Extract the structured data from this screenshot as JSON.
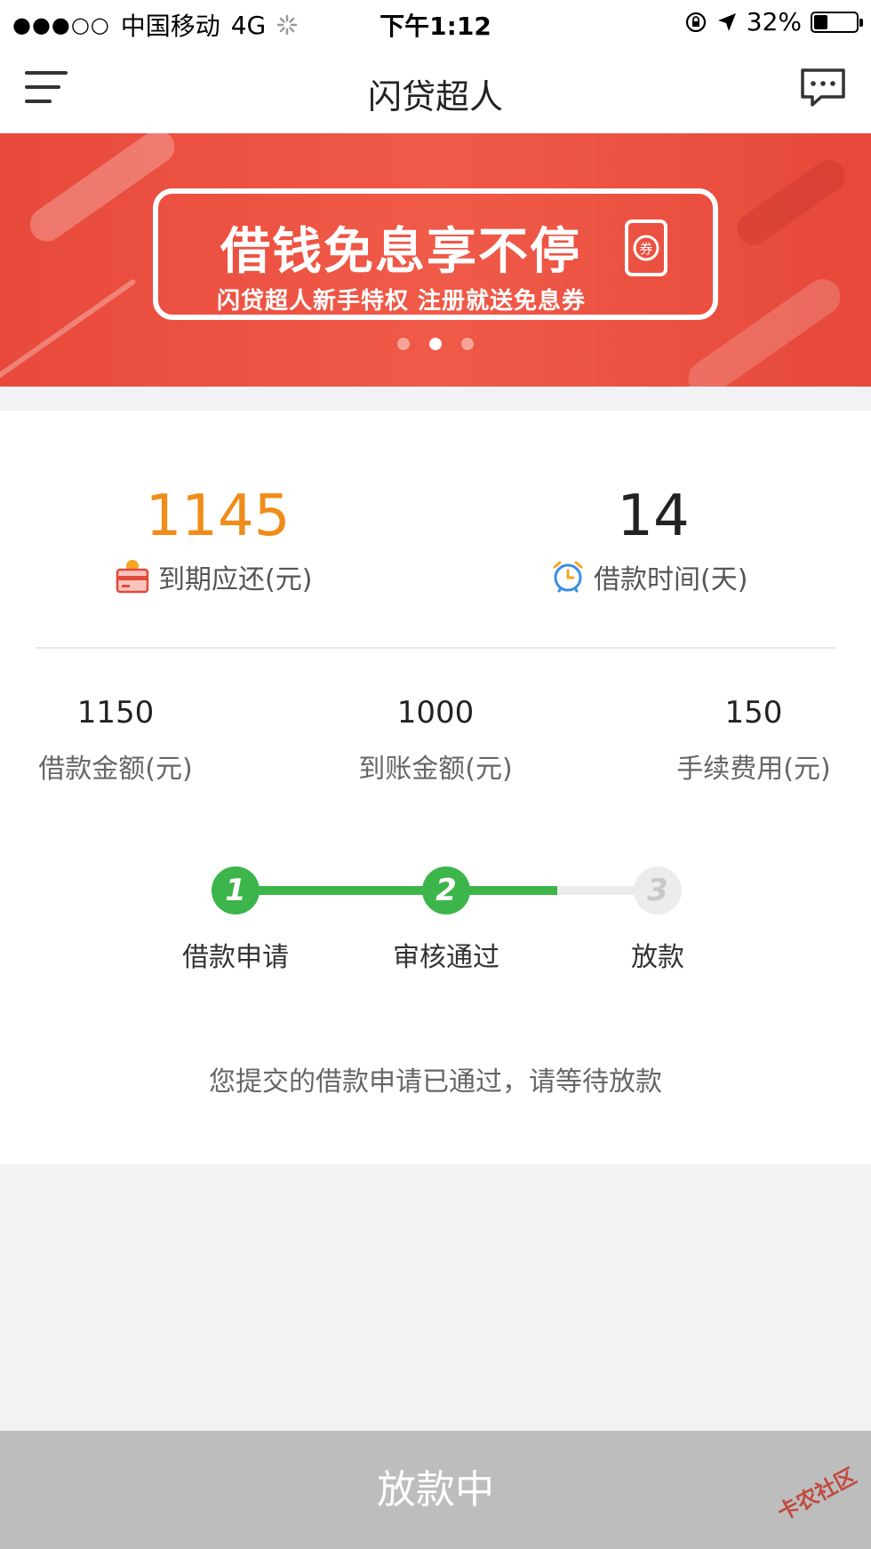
{
  "status": {
    "signal": "●●●○○",
    "carrier": "中国移动",
    "network": "4G",
    "time": "下午1:12",
    "battery_text": "32%",
    "battery_level": 0.32
  },
  "nav": {
    "title": "闪贷超人"
  },
  "banner": {
    "title": "借钱免息享不停",
    "subtitle": "闪贷超人新手特权  注册就送免息券",
    "coupon_char": "券",
    "active_dot": 1,
    "dot_count": 3
  },
  "summary": {
    "repay_amount": "1145",
    "repay_label": "到期应还(元)",
    "loan_days": "14",
    "loan_days_label": "借款时间(天)"
  },
  "details": [
    {
      "value": "1150",
      "label": "借款金额(元)"
    },
    {
      "value": "1000",
      "label": "到账金额(元)"
    },
    {
      "value": "150",
      "label": "手续费用(元)"
    }
  ],
  "steps": [
    {
      "num": "1",
      "label": "借款申请",
      "done": true
    },
    {
      "num": "2",
      "label": "审核通过",
      "done": true
    },
    {
      "num": "3",
      "label": "放款",
      "done": false
    }
  ],
  "notice": "您提交的借款申请已通过，请等待放款",
  "bottom_button": "放款中",
  "watermark": "卡农社区",
  "colors": {
    "accent": "#f08c1a",
    "step_done": "#3cb54a",
    "step_pending": "#e6e6e6",
    "banner": "#ea4c3c"
  }
}
